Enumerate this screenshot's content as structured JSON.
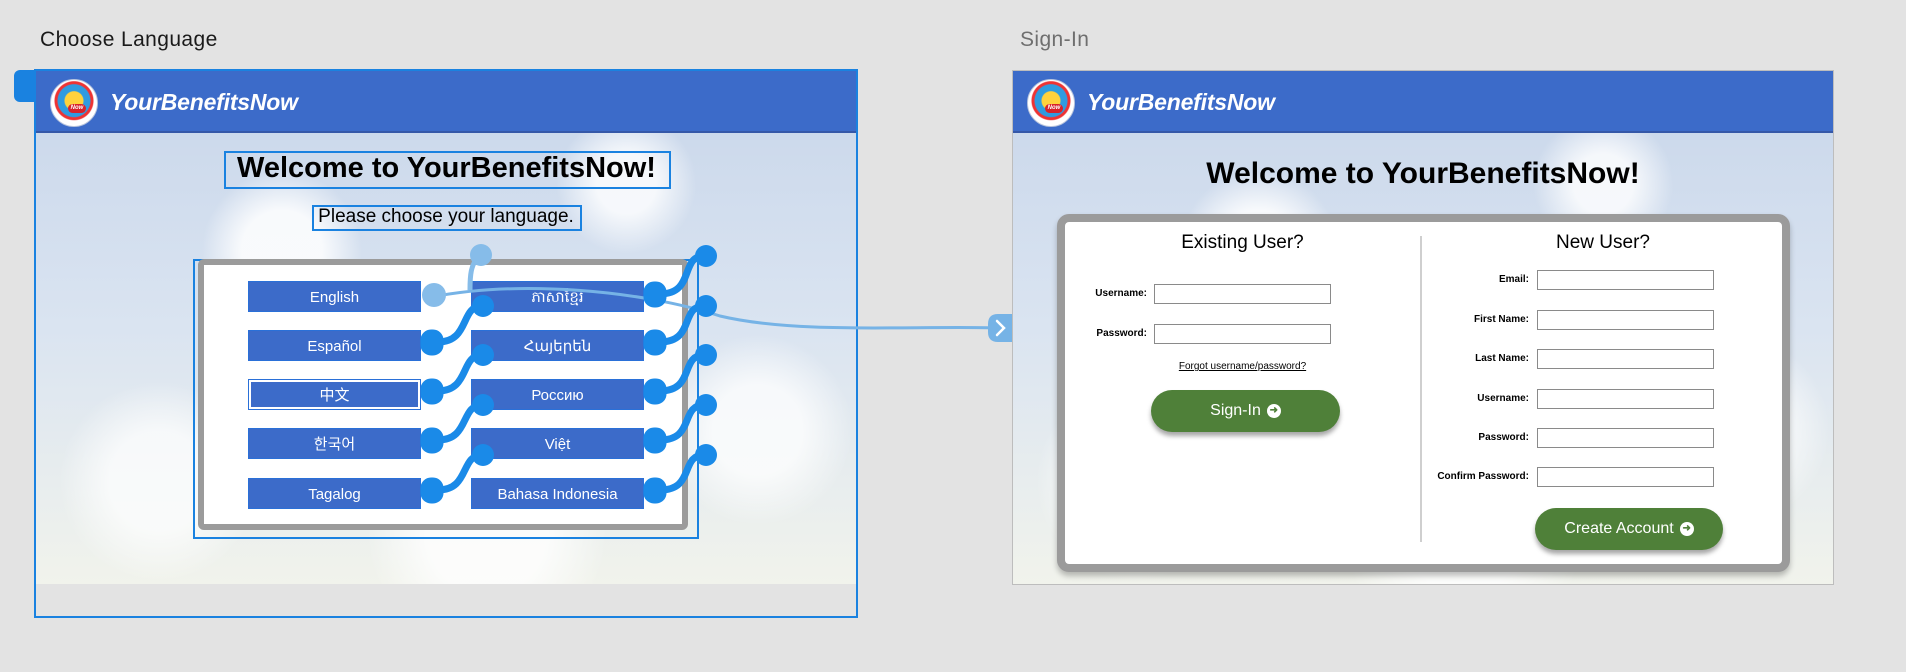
{
  "artboards": {
    "choose_language": {
      "title": "Choose Language"
    },
    "sign_in": {
      "title": "Sign-In"
    }
  },
  "brand": {
    "name": "YourBenefitsNow",
    "logo_badge": "Now"
  },
  "choose_language_screen": {
    "welcome": "Welcome to YourBenefitsNow!",
    "prompt": "Please choose your language.",
    "languages": [
      "English",
      "ភាសាខ្មែរ",
      "Español",
      "Հայերեն",
      "中文",
      "Россию",
      "한국어",
      "Việt",
      "Tagalog",
      "Bahasa Indonesia"
    ]
  },
  "sign_in_screen": {
    "welcome": "Welcome to YourBenefitsNow!",
    "existing_user": {
      "title": "Existing User?",
      "username_label": "Username:",
      "password_label": "Password:",
      "forgot_link": "Forgot username/password?",
      "sign_in_button": "Sign-In"
    },
    "new_user": {
      "title": "New User?",
      "email_label": "Email:",
      "first_name_label": "First Name:",
      "last_name_label": "Last Name:",
      "username_label": "Username:",
      "password_label": "Password:",
      "confirm_password_label": "Confirm Password:",
      "create_button": "Create Account"
    }
  },
  "colors": {
    "header_blue": "#3c6bc9",
    "selection_blue": "#1a82e0",
    "button_green": "#4f8039",
    "panel_border": "#9b9b9b",
    "canvas_bg": "#e3e3e3"
  }
}
